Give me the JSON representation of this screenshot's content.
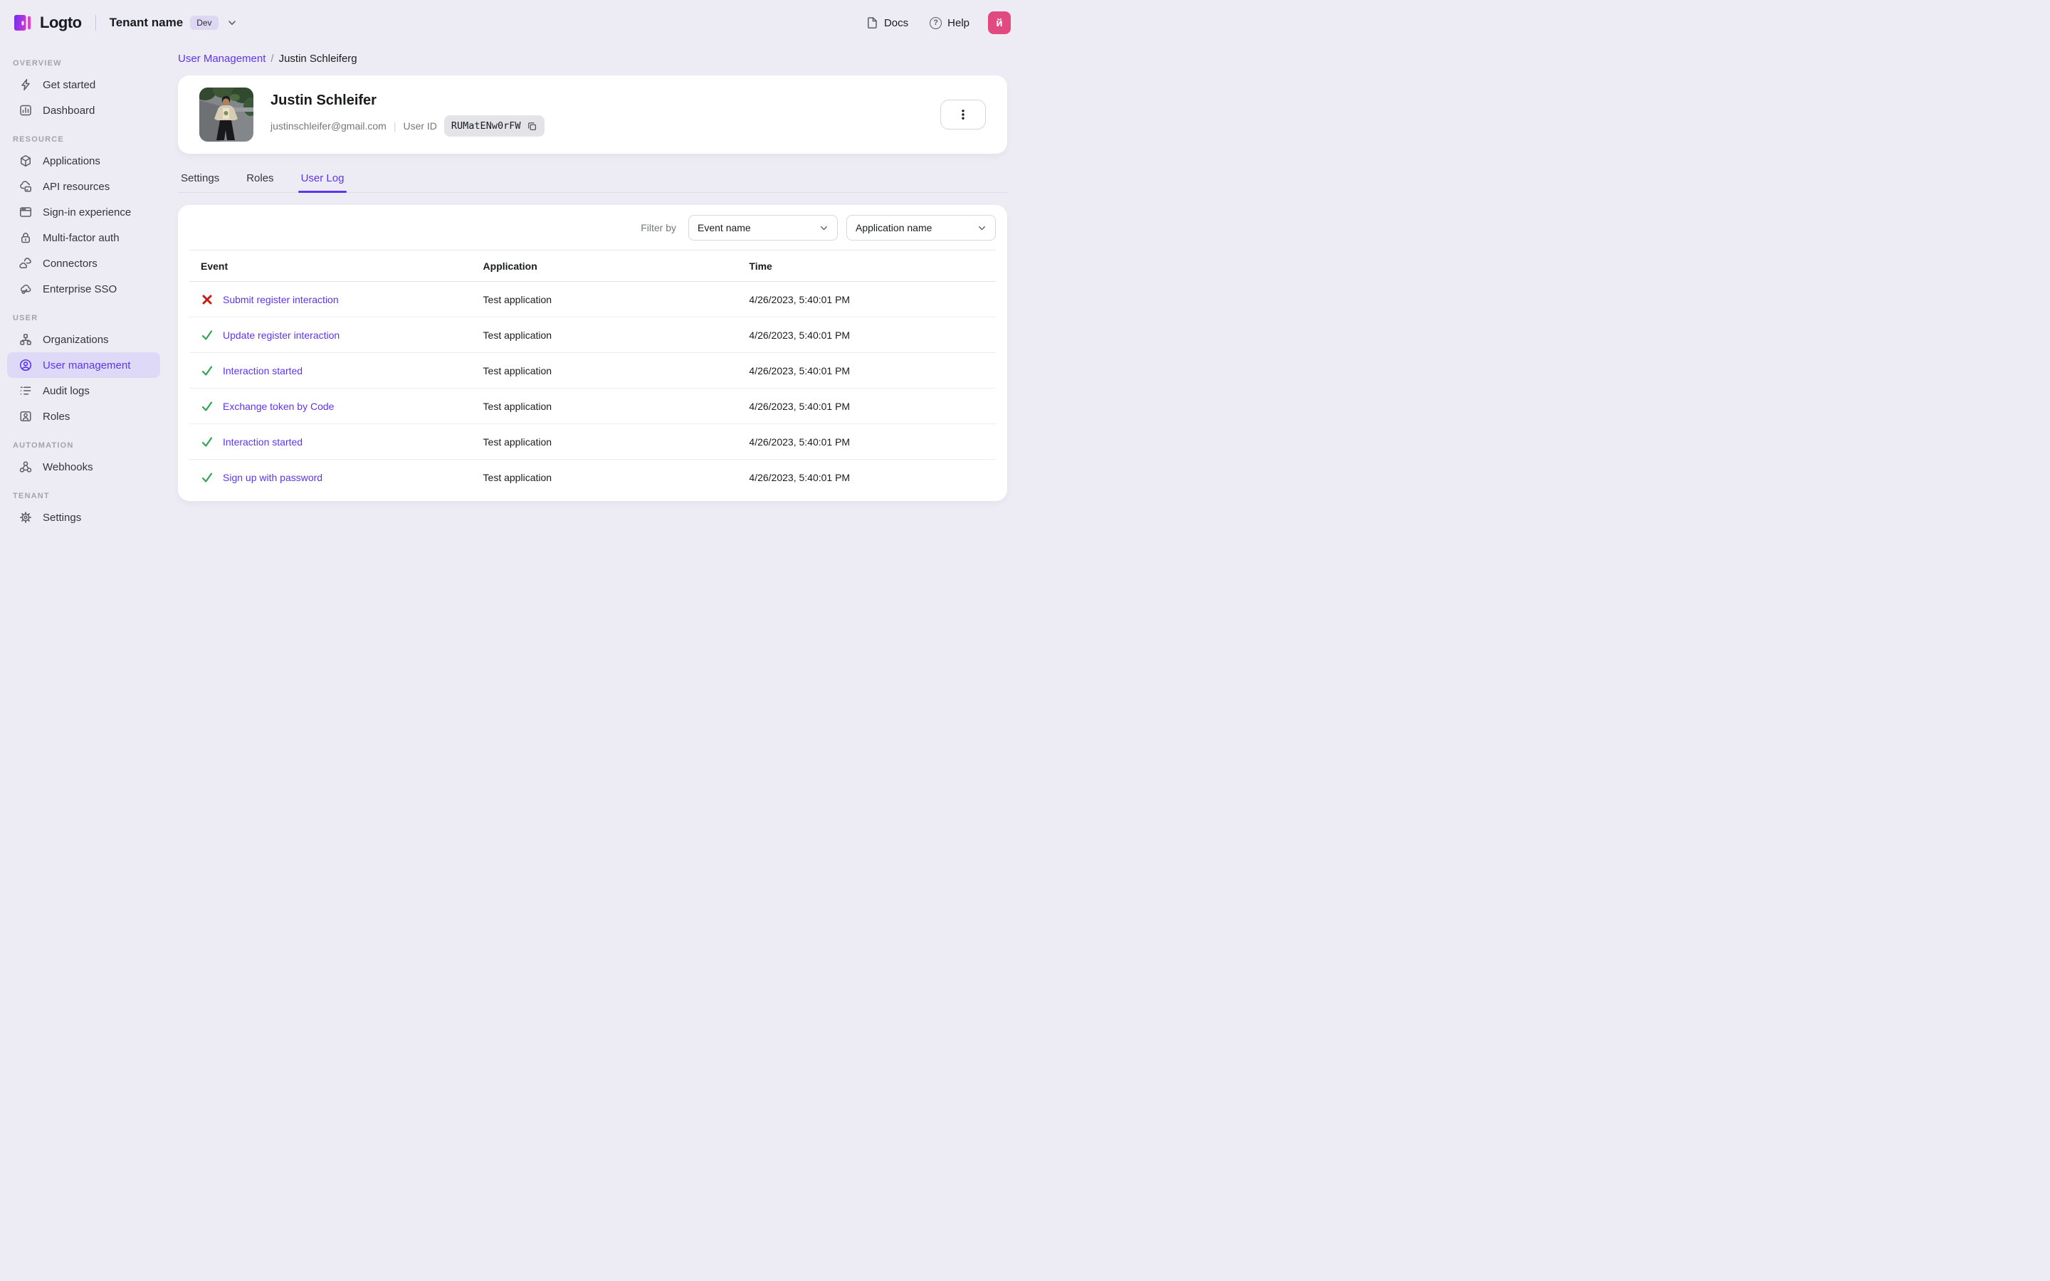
{
  "topbar": {
    "logo_text": "Logto",
    "tenant_name": "Tenant name",
    "tenant_badge": "Dev",
    "docs_label": "Docs",
    "help_label": "Help",
    "help_glyph": "?",
    "avatar_letter": "й"
  },
  "sidebar": {
    "sections": [
      {
        "label": "OVERVIEW",
        "items": [
          {
            "label": "Get started"
          },
          {
            "label": "Dashboard"
          }
        ]
      },
      {
        "label": "RESOURCE",
        "items": [
          {
            "label": "Applications"
          },
          {
            "label": "API resources"
          },
          {
            "label": "Sign-in experience"
          },
          {
            "label": "Multi-factor auth"
          },
          {
            "label": "Connectors"
          },
          {
            "label": "Enterprise SSO"
          }
        ]
      },
      {
        "label": "USER",
        "items": [
          {
            "label": "Organizations"
          },
          {
            "label": "User management",
            "active": true
          },
          {
            "label": "Audit logs"
          },
          {
            "label": "Roles"
          }
        ]
      },
      {
        "label": "AUTOMATION",
        "items": [
          {
            "label": "Webhooks"
          }
        ]
      },
      {
        "label": "TENANT",
        "items": [
          {
            "label": "Settings"
          }
        ]
      }
    ]
  },
  "breadcrumb": {
    "parent": "User Management",
    "separator": "/",
    "current": "Justin Schleiferg"
  },
  "user_card": {
    "name": "Justin Schleifer",
    "email": "justinschleifer@gmail.com",
    "meta_divider": "|",
    "user_id_label": "User ID",
    "user_id": "RUMatENw0rFW"
  },
  "tabs": [
    {
      "label": "Settings"
    },
    {
      "label": "Roles"
    },
    {
      "label": "User Log",
      "active": true
    }
  ],
  "log": {
    "filter_label": "Filter by",
    "filters": [
      {
        "value": "Event name"
      },
      {
        "value": "Application name"
      }
    ],
    "table": {
      "headers": [
        "Event",
        "Application",
        "Time"
      ],
      "rows": [
        {
          "status": "error",
          "event": "Submit register interaction",
          "application": "Test application",
          "time": "4/26/2023, 5:40:01 PM"
        },
        {
          "status": "success",
          "event": "Update register interaction",
          "application": "Test application",
          "time": "4/26/2023, 5:40:01 PM"
        },
        {
          "status": "success",
          "event": "Interaction started",
          "application": "Test application",
          "time": "4/26/2023, 5:40:01 PM"
        },
        {
          "status": "success",
          "event": "Exchange token by Code",
          "application": "Test application",
          "time": "4/26/2023, 5:40:01 PM"
        },
        {
          "status": "success",
          "event": "Interaction started",
          "application": "Test application",
          "time": "4/26/2023, 5:40:01 PM"
        },
        {
          "status": "success",
          "event": "Sign up with password",
          "application": "Test application",
          "time": "4/26/2023, 5:40:01 PM"
        }
      ]
    }
  },
  "colors": {
    "accent": "#5d34f2",
    "accent_light": "#ded9f6",
    "page_bg": "#edebf4",
    "success": "#32a455",
    "error": "#c51d12",
    "avatar_bg": "#e2497e"
  }
}
